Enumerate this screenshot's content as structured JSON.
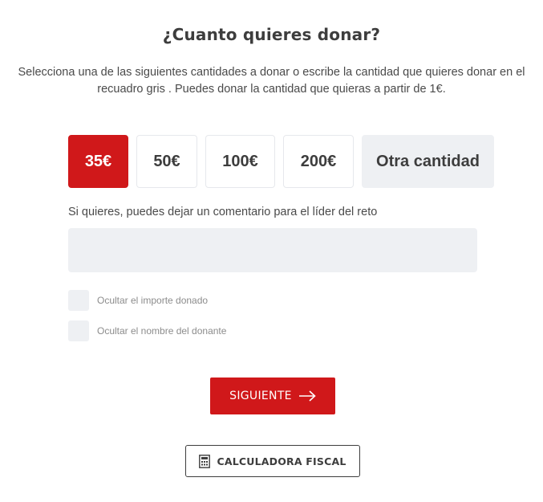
{
  "header": {
    "title": "¿Cuanto quieres donar?",
    "subtitle": "Selecciona una de las siguientes cantidades a donar o escribe la cantidad que quieres donar en el recuadro gris . Puedes donar la cantidad que quieras a partir de 1€."
  },
  "amounts": {
    "options": [
      {
        "label": "35€",
        "selected": true
      },
      {
        "label": "50€",
        "selected": false
      },
      {
        "label": "100€",
        "selected": false
      },
      {
        "label": "200€",
        "selected": false
      }
    ],
    "other_label": "Otra cantidad"
  },
  "comment": {
    "label": "Si quieres, puedes dejar un comentario para el líder del reto",
    "value": "",
    "placeholder": ""
  },
  "options": {
    "hide_amount_label": "Ocultar el importe donado",
    "hide_amount_checked": false,
    "hide_name_label": "Ocultar el nombre del donante",
    "hide_name_checked": false
  },
  "actions": {
    "next_label": "SIGUIENTE",
    "next_icon": "arrow-right-icon",
    "calculator_label": "CALCULADORA FISCAL",
    "calculator_icon": "calculator-icon"
  },
  "colors": {
    "accent": "#d0181a",
    "field_bg": "#eef0f3",
    "text": "#3d3d3d"
  }
}
